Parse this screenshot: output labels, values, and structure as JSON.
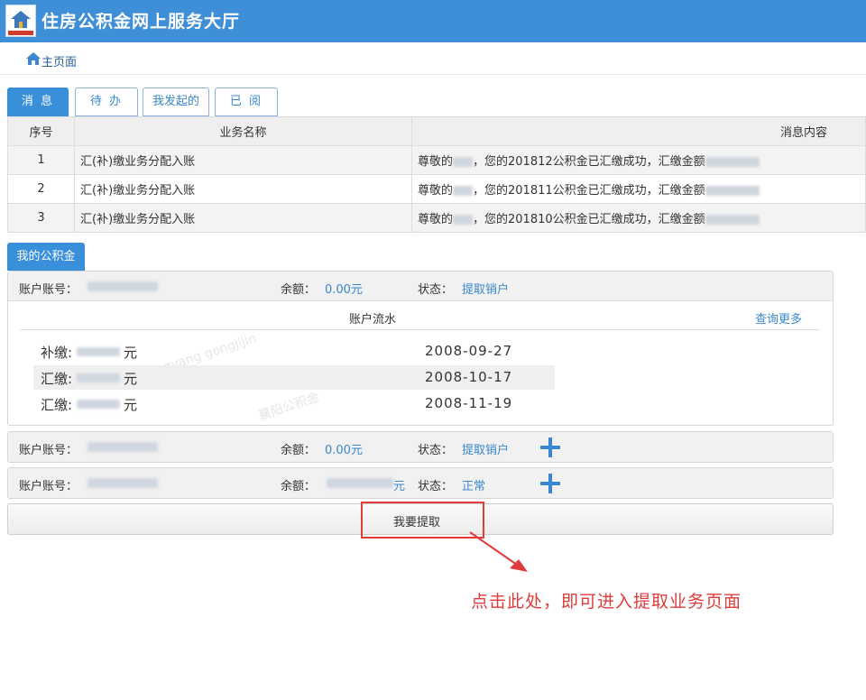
{
  "header": {
    "title": "住房公积金网上服务大厅"
  },
  "breadcrumb": {
    "home": "主页面"
  },
  "tabs": [
    {
      "label": "消 息"
    },
    {
      "label": "待 办"
    },
    {
      "label": "我发起的"
    },
    {
      "label": "已 阅"
    }
  ],
  "messages": {
    "columns": [
      "序号",
      "业务名称",
      "消息内容"
    ],
    "rows": [
      {
        "no": "1",
        "name": "汇(补)缴业务分配入账",
        "prefix": "尊敬的",
        "text": "，您的201812公积金已汇缴成功，汇缴金额"
      },
      {
        "no": "2",
        "name": "汇(补)缴业务分配入账",
        "prefix": "尊敬的",
        "text": "，您的201811公积金已汇缴成功，汇缴金额"
      },
      {
        "no": "3",
        "name": "汇(补)缴业务分配入账",
        "prefix": "尊敬的",
        "text": "，您的201810公积金已汇缴成功，汇缴金额"
      }
    ]
  },
  "my_fund": {
    "label": "我的公积金",
    "account_label": "账户账号：",
    "balance_label": "余额：",
    "status_label": "状态：",
    "accounts": [
      {
        "balance": "0.00元",
        "status": "提取销户"
      },
      {
        "balance": "0.00元",
        "status": "提取销户"
      },
      {
        "balance": "元",
        "status": "正常"
      }
    ],
    "flow": {
      "title": "账户流水",
      "more": "查询更多",
      "rows": [
        {
          "type": "补缴:",
          "unit": "元",
          "date": "2008-09-27"
        },
        {
          "type": "汇缴:",
          "unit": "元",
          "date": "2008-10-17"
        },
        {
          "type": "汇缴:",
          "unit": "元",
          "date": "2008-11-19"
        }
      ]
    }
  },
  "withdraw_button": "我要提取",
  "annotation": "点击此处，即可进入提取业务页面",
  "watermarks": [
    "xiangyang gongjijin",
    "襄阳公积金"
  ],
  "colors": {
    "header": "#3f8fd8",
    "accent": "#3a87d0",
    "annotation": "#e03c3c"
  }
}
